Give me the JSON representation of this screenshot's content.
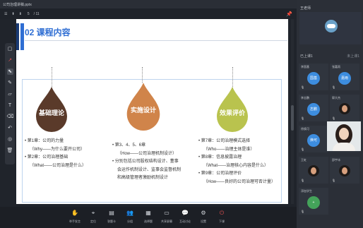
{
  "window": {
    "title": "公司治理讲稿.pptx"
  },
  "slide_toolbar": {
    "page_current": "5",
    "page_total": "/ 11"
  },
  "slide": {
    "heading": "02 课程内容",
    "pillars": [
      {
        "label": "基础理论",
        "color": "#5a3a2a"
      },
      {
        "label": "实施设计",
        "color": "#d0844a"
      },
      {
        "label": "效果评价",
        "color": "#b9c34e"
      }
    ],
    "columns": [
      {
        "lines": [
          "• 第1章：公司的力量",
          "（Why——为什么要开公司）",
          "• 第2章：公司治理基础",
          "（What——公司治理是什么）"
        ]
      },
      {
        "lines": [
          "• 第3、4、5、6章",
          "（How——公司治理机制设计）",
          "• 分别包括公司股权结构设计、董事",
          "会运作机制设计、监事会监督机制",
          "和高级管理者激励机制设计"
        ]
      },
      {
        "lines": [
          "• 第7章：公司治理模式选择",
          "（Who——治理主体是谁）",
          "• 第8章：信息披露治理",
          "（What——治理核心内容是什么）",
          "• 第9章：公司治理评价",
          "（How——良好的公司治理可否计量）"
        ]
      }
    ]
  },
  "bottom_toolbar": [
    {
      "icon": "hand-icon",
      "label": "举手发言"
    },
    {
      "icon": "location-icon",
      "label": "定位"
    },
    {
      "icon": "document-icon",
      "label": "答题卡"
    },
    {
      "icon": "people-icon",
      "label": "分组"
    },
    {
      "icon": "chart-icon",
      "label": "选择题"
    },
    {
      "icon": "screen-icon",
      "label": "共享屏幕"
    },
    {
      "icon": "chat-icon",
      "label": "互动讨论"
    },
    {
      "icon": "gear-icon",
      "label": "设置"
    },
    {
      "icon": "power-icon",
      "label": "下课"
    }
  ],
  "panel": {
    "teacher_title": "王老师",
    "stat_left": "已上课1",
    "stat_right": "未上课1",
    "participants": [
      {
        "name": "李国基",
        "avatar_text": "国基",
        "color": "#3d8ddf",
        "type": "circle"
      },
      {
        "name": "张嘉雨",
        "avatar_text": "嘉雨",
        "color": "#3d8ddf",
        "type": "circle"
      },
      {
        "name": "李志鹏",
        "avatar_text": "志鹏",
        "color": "#3d8ddf",
        "type": "circle"
      },
      {
        "name": "郭大杰",
        "avatar_text": "",
        "color": "#30353e",
        "type": "photo"
      },
      {
        "name": "徐焕可",
        "avatar_text": "焕可",
        "color": "#3d8ddf",
        "type": "circle"
      },
      {
        "name": "贾珍珍",
        "avatar_text": "珍珍",
        "color": "#3d8ddf",
        "type": "circle"
      },
      {
        "name": "王虹",
        "avatar_text": "",
        "color": "#30353e",
        "type": "photo"
      },
      {
        "name": "邵宇冰",
        "avatar_text": "",
        "color": "#30353e",
        "type": "photo"
      },
      {
        "name": "添加学生",
        "avatar_text": "+",
        "color": "#44a35a",
        "type": "circle"
      }
    ]
  }
}
